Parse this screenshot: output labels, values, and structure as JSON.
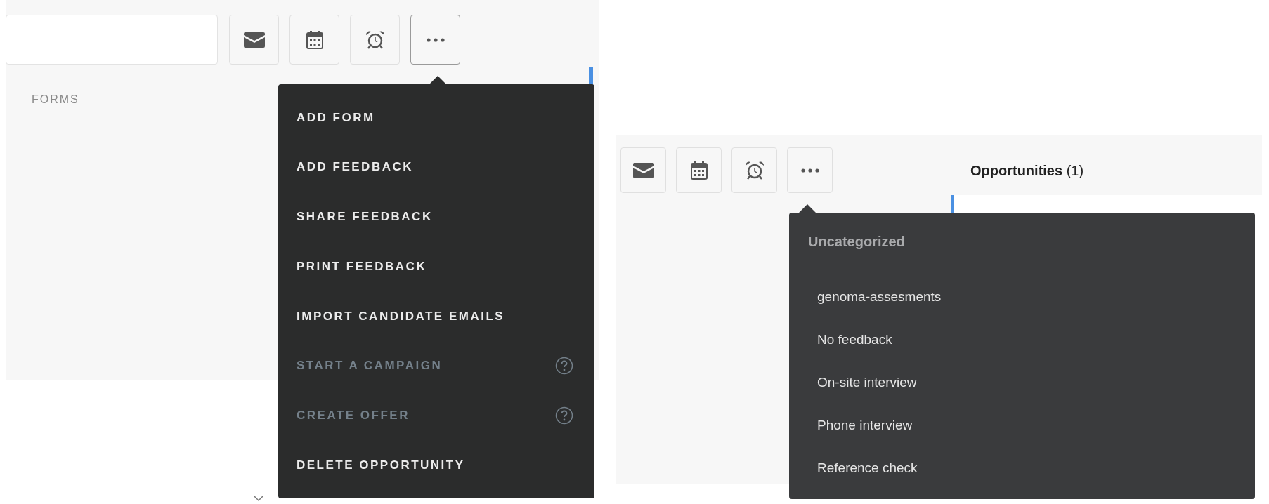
{
  "left_panel": {
    "toolbar": [
      {
        "kind": "mail",
        "expanded": false
      },
      {
        "kind": "calendar",
        "expanded": false
      },
      {
        "kind": "alarm",
        "expanded": false
      },
      {
        "kind": "more",
        "expanded": true
      }
    ],
    "section_label": "FORMS",
    "menu": [
      {
        "label": "ADD FORM",
        "disabled": false,
        "help": false
      },
      {
        "label": "ADD FEEDBACK",
        "disabled": false,
        "help": false
      },
      {
        "label": "SHARE FEEDBACK",
        "disabled": false,
        "help": false
      },
      {
        "label": "PRINT FEEDBACK",
        "disabled": false,
        "help": false
      },
      {
        "label": "IMPORT CANDIDATE EMAILS",
        "disabled": false,
        "help": false
      },
      {
        "label": "START A CAMPAIGN",
        "disabled": true,
        "help": true
      },
      {
        "label": "CREATE OFFER",
        "disabled": true,
        "help": true
      },
      {
        "label": "DELETE OPPORTUNITY",
        "disabled": false,
        "help": false
      }
    ]
  },
  "right_panel": {
    "toolbar": [
      {
        "kind": "mail",
        "expanded": false
      },
      {
        "kind": "calendar",
        "expanded": false
      },
      {
        "kind": "alarm",
        "expanded": false
      },
      {
        "kind": "more",
        "expanded": false
      }
    ],
    "heading": "**Opportunities** (1)",
    "menu": {
      "header": "Uncategorized",
      "items": [
        "genoma-assesments",
        "No feedback",
        "On-site interview",
        "Phone interview",
        "Reference check"
      ]
    }
  }
}
